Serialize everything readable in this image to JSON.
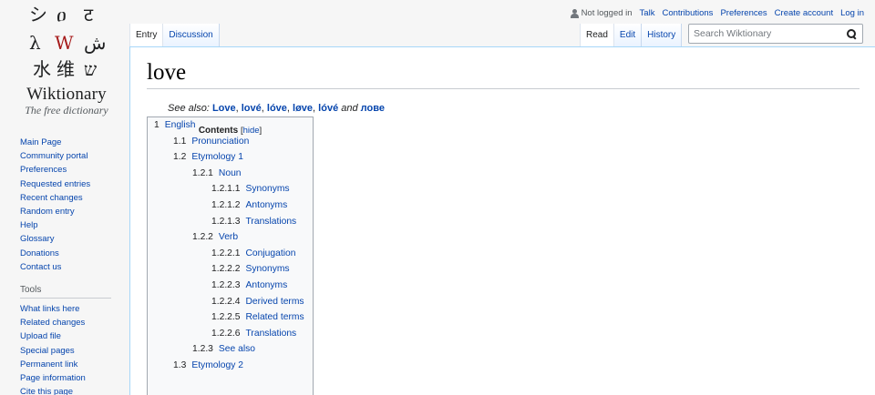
{
  "logo": {
    "glyphs": [
      "シ",
      "ዐ",
      "ट",
      "λ",
      "W",
      "ش",
      "水",
      "维",
      "ש"
    ],
    "wordmark": "Wiktionary",
    "tagline": "The free dictionary",
    "colors": {
      "ink": "#202122",
      "accent": "#a61b1b"
    }
  },
  "sidebar": {
    "navigation": [
      "Main Page",
      "Community portal",
      "Preferences",
      "Requested entries",
      "Recent changes",
      "Random entry",
      "Help",
      "Glossary",
      "Donations",
      "Contact us"
    ],
    "tools_heading": "Tools",
    "tools": [
      "What links here",
      "Related changes",
      "Upload file",
      "Special pages",
      "Permanent link",
      "Page information",
      "Cite this page"
    ]
  },
  "personal": {
    "user_icon": "user-icon",
    "not_logged_in": "Not logged in",
    "links": [
      "Talk",
      "Contributions",
      "Preferences",
      "Create account",
      "Log in"
    ]
  },
  "tabs": {
    "left": [
      "Entry",
      "Discussion"
    ],
    "right": [
      "Read",
      "Edit",
      "History"
    ]
  },
  "search": {
    "placeholder": "Search Wiktionary",
    "icon": "search-icon"
  },
  "page": {
    "title": "love",
    "see_also": {
      "lead": "See also:",
      "variants": [
        "Love",
        "lové",
        "lóve",
        "løve",
        "lóvé"
      ],
      "and": "and",
      "last": "лове"
    }
  },
  "toc": {
    "heading": "Contents",
    "toggle_open": "[",
    "toggle": "hide",
    "toggle_close": "]",
    "items": [
      {
        "num": "1",
        "label": "English",
        "level": 1
      },
      {
        "num": "1.1",
        "label": "Pronunciation",
        "level": 2
      },
      {
        "num": "1.2",
        "label": "Etymology 1",
        "level": 2
      },
      {
        "num": "1.2.1",
        "label": "Noun",
        "level": 3
      },
      {
        "num": "1.2.1.1",
        "label": "Synonyms",
        "level": 4
      },
      {
        "num": "1.2.1.2",
        "label": "Antonyms",
        "level": 4
      },
      {
        "num": "1.2.1.3",
        "label": "Translations",
        "level": 4
      },
      {
        "num": "1.2.2",
        "label": "Verb",
        "level": 3
      },
      {
        "num": "1.2.2.1",
        "label": "Conjugation",
        "level": 4
      },
      {
        "num": "1.2.2.2",
        "label": "Synonyms",
        "level": 4
      },
      {
        "num": "1.2.2.3",
        "label": "Antonyms",
        "level": 4
      },
      {
        "num": "1.2.2.4",
        "label": "Derived terms",
        "level": 4
      },
      {
        "num": "1.2.2.5",
        "label": "Related terms",
        "level": 4
      },
      {
        "num": "1.2.2.6",
        "label": "Translations",
        "level": 4
      },
      {
        "num": "1.2.3",
        "label": "See also",
        "level": 3
      },
      {
        "num": "1.3",
        "label": "Etymology 2",
        "level": 2
      }
    ]
  }
}
